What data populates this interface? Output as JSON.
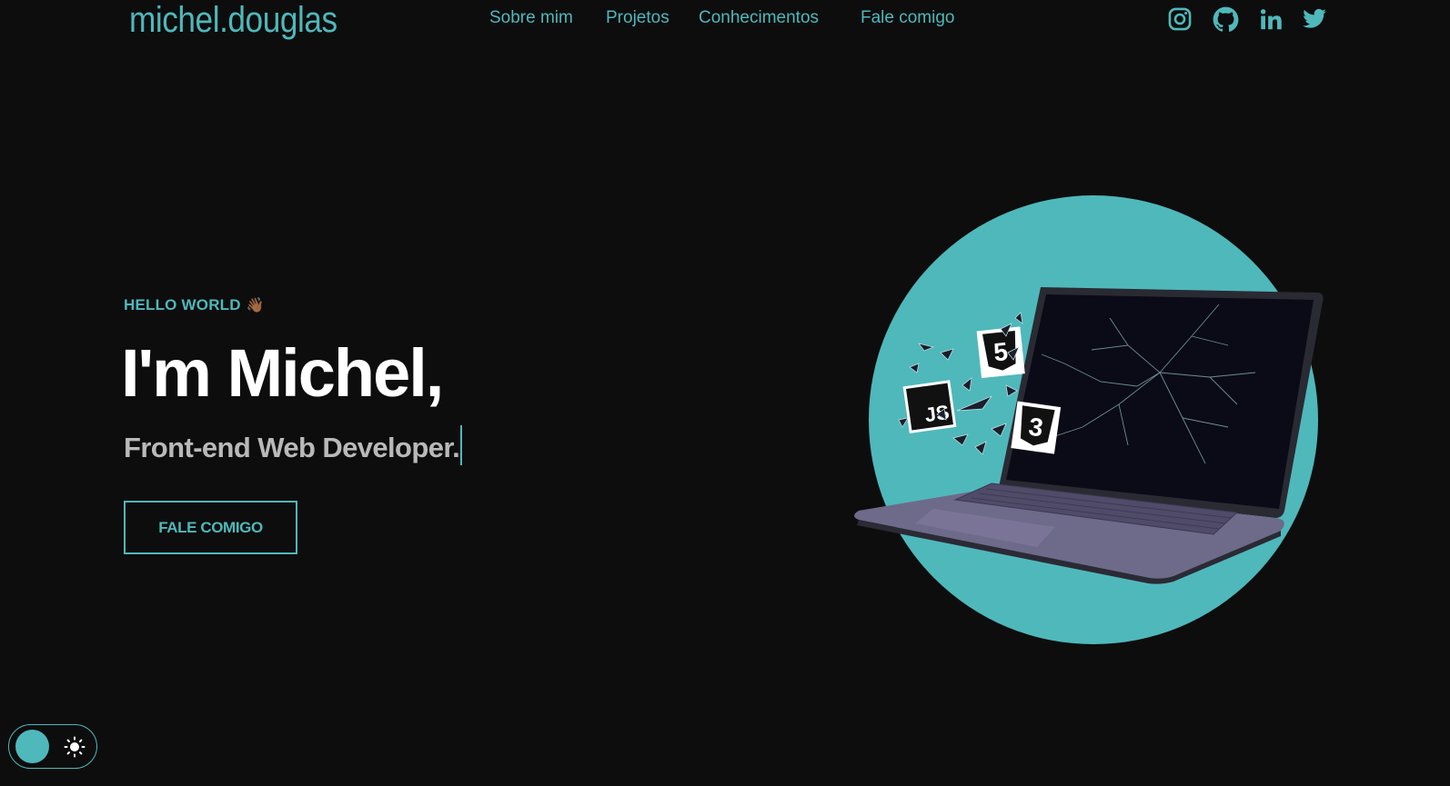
{
  "header": {
    "logo": "michel.douglas",
    "nav": [
      {
        "label": "Sobre mim"
      },
      {
        "label": "Projetos"
      },
      {
        "label": "Conhecimentos"
      },
      {
        "label": "Fale comigo"
      }
    ],
    "socials": [
      {
        "name": "instagram-icon"
      },
      {
        "name": "github-icon"
      },
      {
        "name": "linkedin-icon"
      },
      {
        "name": "twitter-icon"
      }
    ]
  },
  "hero": {
    "greeting": "HELLO WORLD",
    "greeting_emoji": "👋🏾",
    "headline": "I'm Michel,",
    "subtitle": "Front-end Web Developer.",
    "cta_label": "FALE COMIGO"
  },
  "illustration": {
    "badges": [
      "5",
      "JS",
      "3"
    ]
  },
  "theme_toggle": {
    "icon": "sun-icon",
    "mode": "dark"
  },
  "colors": {
    "accent": "#4fb8bb",
    "background": "#0d0d0d",
    "headline": "#ffffff",
    "subtitle": "#b9b9b9"
  }
}
